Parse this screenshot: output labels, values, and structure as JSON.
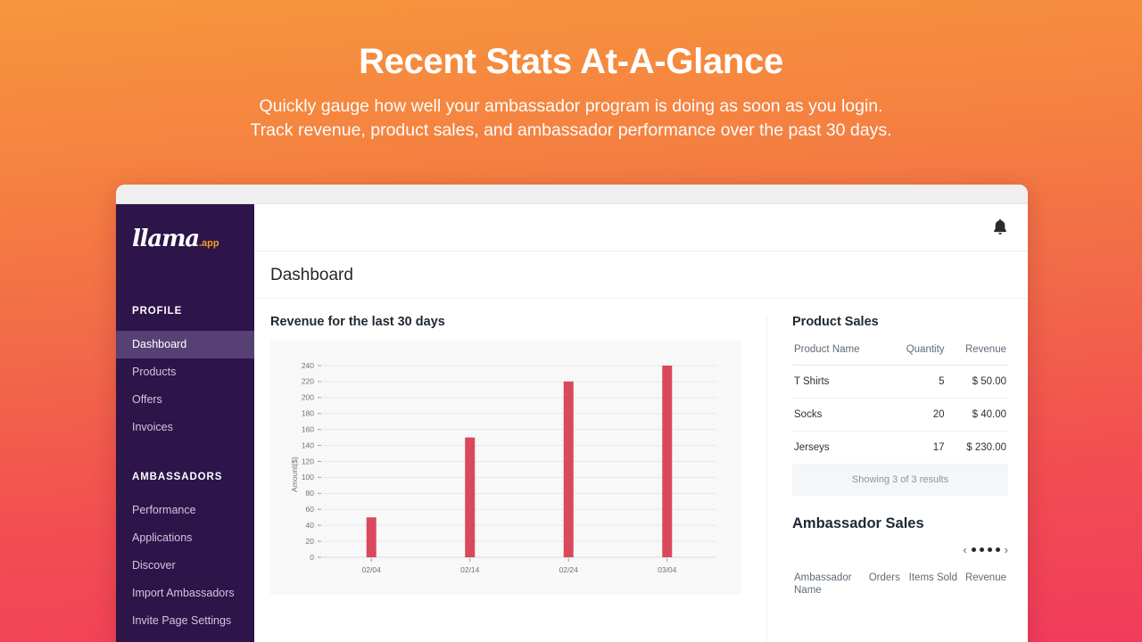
{
  "promo": {
    "title": "Recent Stats At-A-Glance",
    "subtitle_line1": "Quickly gauge how well your ambassador program is doing as soon as you login.",
    "subtitle_line2": "Track revenue, product sales, and ambassador performance over the past 30 days."
  },
  "brand": {
    "logo_word": "llama",
    "logo_suffix": ".app",
    "purple": "#2d1449",
    "active_purple": "#574073",
    "orange": "#f0a020",
    "bar_red": "#d9485c"
  },
  "sidebar": {
    "sections": [
      {
        "heading": "PROFILE",
        "items": [
          {
            "label": "Dashboard",
            "active": true
          },
          {
            "label": "Products",
            "active": false
          },
          {
            "label": "Offers",
            "active": false
          },
          {
            "label": "Invoices",
            "active": false
          }
        ]
      },
      {
        "heading": "AMBASSADORS",
        "items": [
          {
            "label": "Performance",
            "active": false
          },
          {
            "label": "Applications",
            "active": false
          },
          {
            "label": "Discover",
            "active": false
          },
          {
            "label": "Import Ambassadors",
            "active": false
          },
          {
            "label": "Invite Page Settings",
            "active": false
          }
        ]
      }
    ]
  },
  "topbar": {
    "notification_icon": "bell-icon"
  },
  "page": {
    "title": "Dashboard"
  },
  "chart_data": {
    "type": "bar",
    "title": "Revenue for the last 30 days",
    "categories": [
      "02/04",
      "02/14",
      "02/24",
      "03/04"
    ],
    "values": [
      50,
      150,
      220,
      240
    ],
    "xlabel": "",
    "ylabel": "Amount($)",
    "ylim": [
      0,
      240
    ],
    "yticks": [
      0,
      20,
      40,
      60,
      80,
      100,
      120,
      140,
      160,
      180,
      200,
      220,
      240
    ],
    "grid": true,
    "legend": "none",
    "bar_color": "#d9485c",
    "plot_bg": "#f8f8f9"
  },
  "product_sales": {
    "title": "Product Sales",
    "columns": [
      "Product Name",
      "Quantity",
      "Revenue"
    ],
    "rows": [
      {
        "name": "T Shirts",
        "quantity": "5",
        "revenue": "$ 50.00"
      },
      {
        "name": "Socks",
        "quantity": "20",
        "revenue": "$ 40.00"
      },
      {
        "name": "Jerseys",
        "quantity": "17",
        "revenue": "$ 230.00"
      }
    ],
    "footer": "Showing 3 of 3 results"
  },
  "ambassador_sales": {
    "title": "Ambassador Sales",
    "pager": {
      "prev": "‹",
      "next": "›",
      "dot_count": 4
    },
    "columns": [
      "Ambassador Name",
      "Orders",
      "Items Sold",
      "Revenue"
    ]
  }
}
